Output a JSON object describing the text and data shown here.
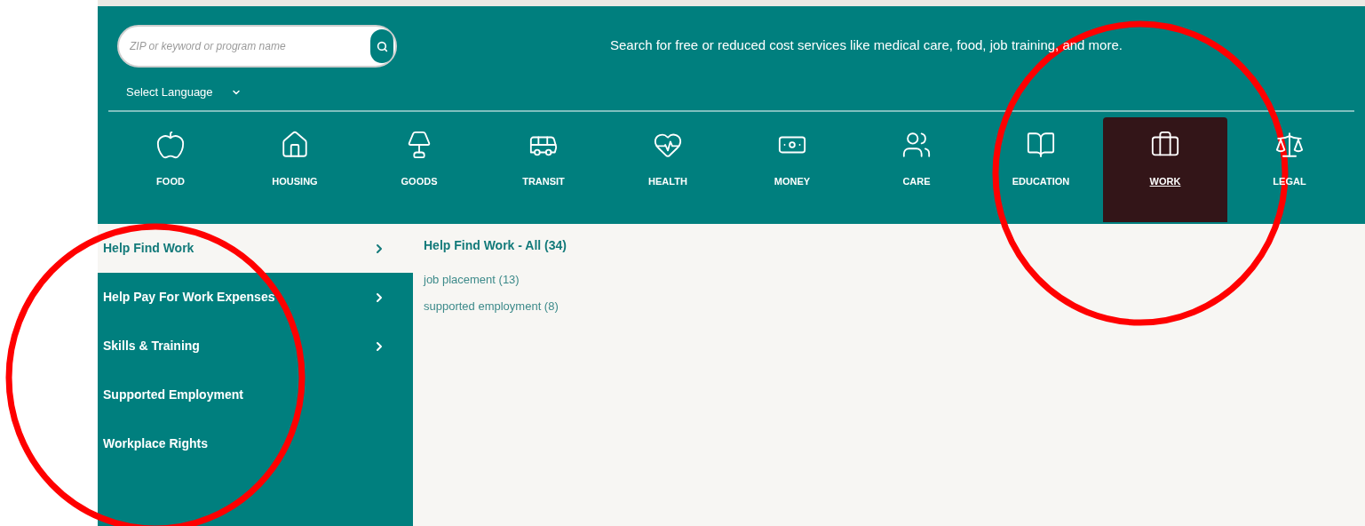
{
  "search": {
    "placeholder": "ZIP or keyword or program name"
  },
  "language": {
    "label": "Select Language"
  },
  "tagline": "Search for free or reduced cost services like medical care, food, job training, and more.",
  "categories": [
    {
      "kind": "food",
      "label": "FOOD",
      "selected": false
    },
    {
      "kind": "housing",
      "label": "HOUSING",
      "selected": false
    },
    {
      "kind": "goods",
      "label": "GOODS",
      "selected": false
    },
    {
      "kind": "transit",
      "label": "TRANSIT",
      "selected": false
    },
    {
      "kind": "health",
      "label": "HEALTH",
      "selected": false
    },
    {
      "kind": "money",
      "label": "MONEY",
      "selected": false
    },
    {
      "kind": "care",
      "label": "CARE",
      "selected": false
    },
    {
      "kind": "education",
      "label": "EDUCATION",
      "selected": false
    },
    {
      "kind": "work",
      "label": "WORK",
      "selected": true
    },
    {
      "kind": "legal",
      "label": "LEGAL",
      "selected": false
    }
  ],
  "sidebar": {
    "items": [
      {
        "label": "Help Find Work",
        "selected": true,
        "has_children": true
      },
      {
        "label": "Help Pay For Work Expenses",
        "selected": false,
        "has_children": true
      },
      {
        "label": "Skills & Training",
        "selected": false,
        "has_children": true
      },
      {
        "label": "Supported Employment",
        "selected": false,
        "has_children": false
      },
      {
        "label": "Workplace Rights",
        "selected": false,
        "has_children": false
      }
    ]
  },
  "content": {
    "heading": "Help Find Work - All (34)",
    "links": [
      "job placement (13)",
      "supported employment (8)"
    ]
  }
}
